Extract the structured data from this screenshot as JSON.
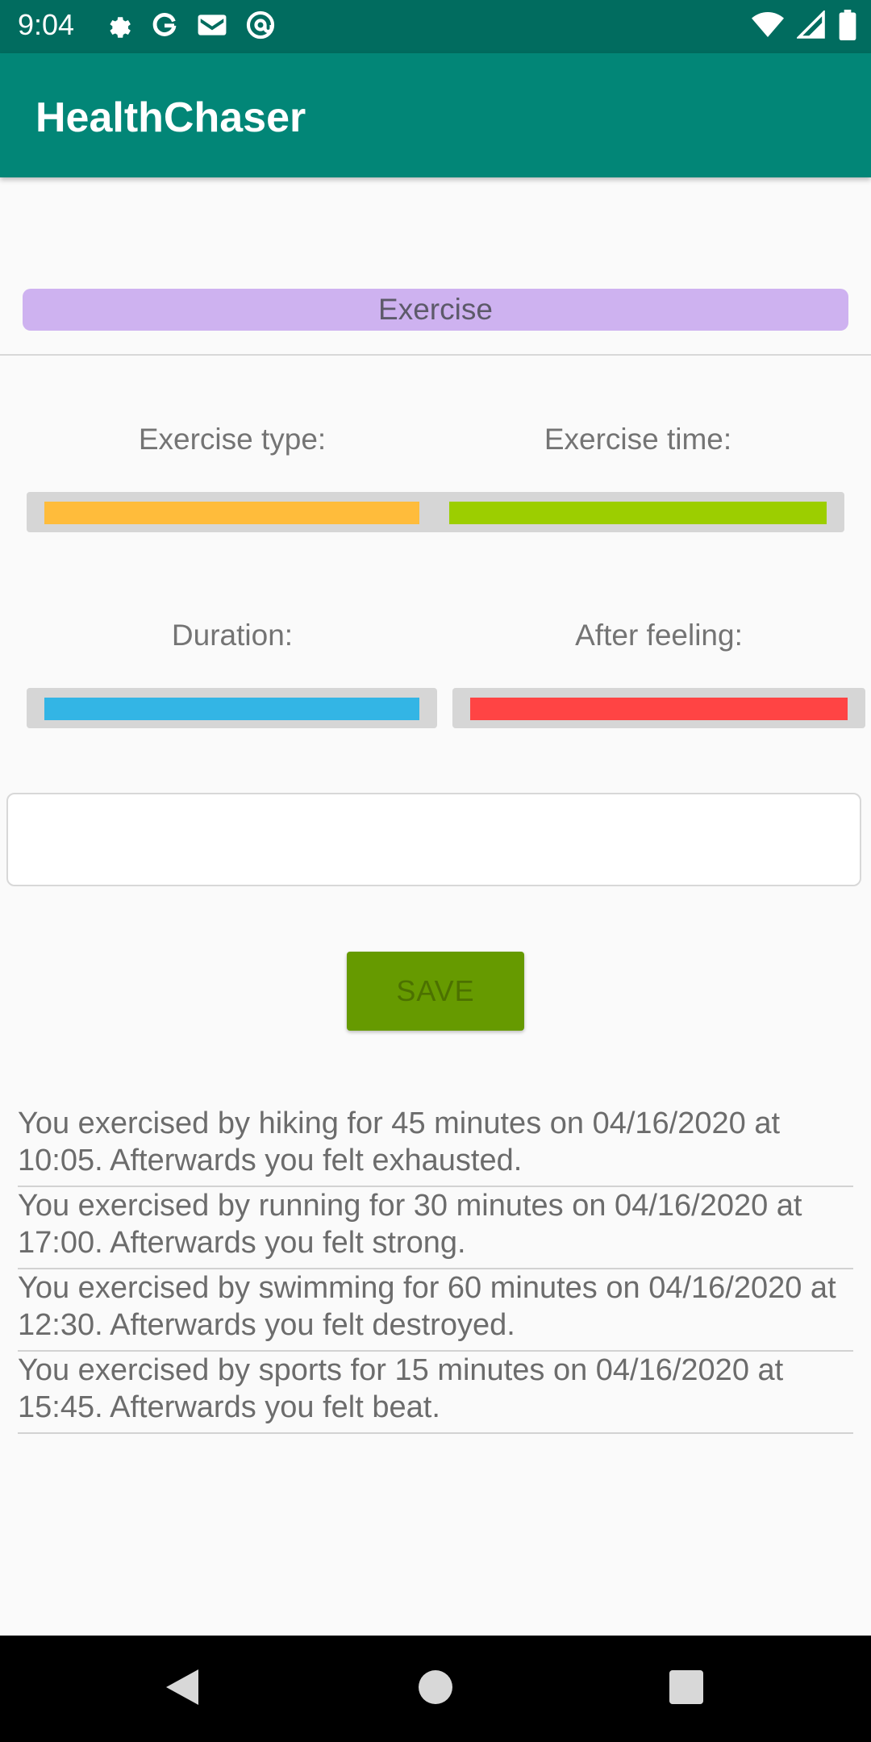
{
  "status_bar": {
    "time": "9:04",
    "icons_left": [
      "settings-icon",
      "google-icon",
      "gmail-icon",
      "at-sign-icon"
    ],
    "icons_right": [
      "wifi-icon",
      "signal-icon",
      "battery-icon"
    ]
  },
  "app_bar": {
    "title": "HealthChaser"
  },
  "tab": {
    "label": "Exercise"
  },
  "fields": {
    "exercise_type": {
      "label": "Exercise type:",
      "color": "#ffbc3b"
    },
    "exercise_time": {
      "label": "Exercise time:",
      "color": "#9cce00"
    },
    "duration": {
      "label": "Duration:",
      "color": "#33b5e5"
    },
    "after_feeling": {
      "label": "After feeling:",
      "color": "#ff4444"
    }
  },
  "note_input": {
    "value": "",
    "placeholder": ""
  },
  "save_button": {
    "label": "SAVE"
  },
  "log_entries": [
    {
      "text": "You exercised by hiking for 45 minutes on 04/16/2020 at 10:05. Afterwards you felt exhausted."
    },
    {
      "text": "You exercised by running for 30 minutes on 04/16/2020 at 17:00. Afterwards you felt strong."
    },
    {
      "text": "You exercised by swimming for 60 minutes on 04/16/2020 at 12:30. Afterwards you felt destroyed."
    },
    {
      "text": "You exercised by sports for 15 minutes on 04/16/2020 at 15:45. Afterwards you felt beat."
    }
  ],
  "nav_bar": {
    "icons": [
      "back-icon",
      "home-icon",
      "recents-icon"
    ]
  }
}
